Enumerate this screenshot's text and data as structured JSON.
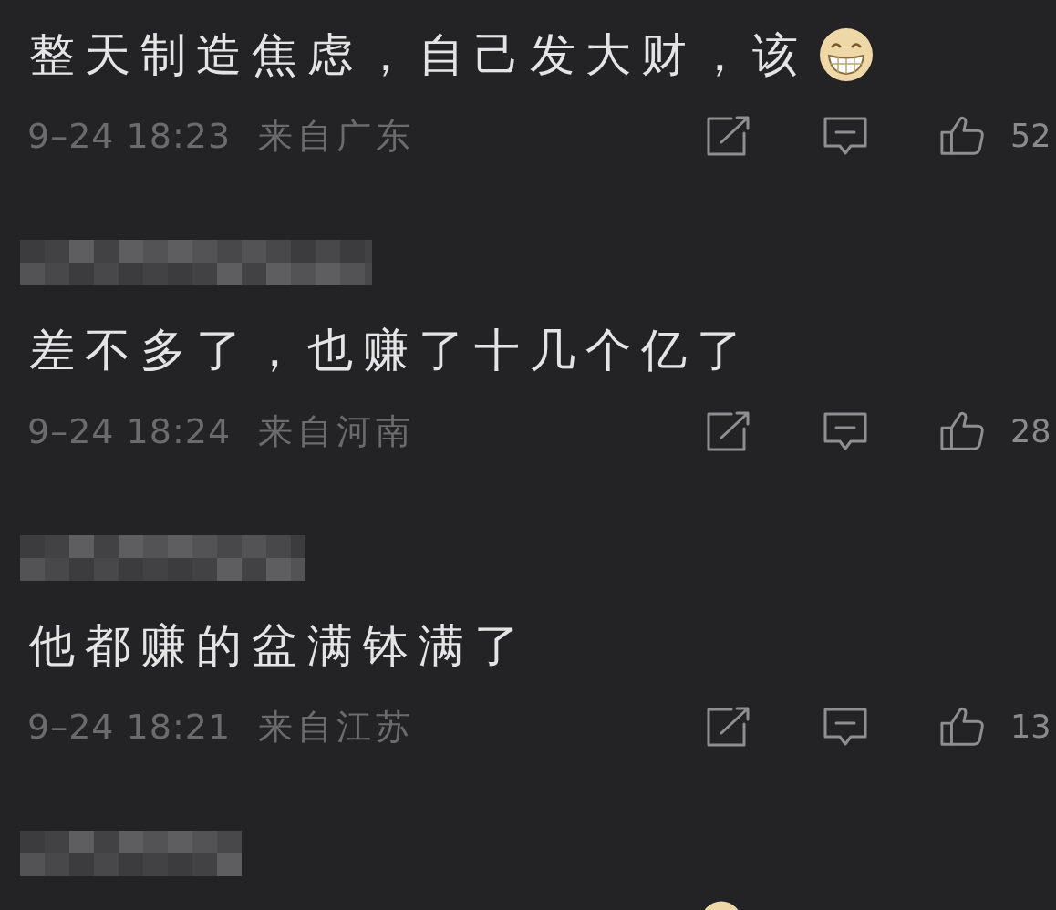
{
  "comments": [
    {
      "kind": "full",
      "username_shown": false,
      "text": "整天制造焦虑，自己发大财，该",
      "emoji": true,
      "time": "9–24 18:23",
      "location": "来自广东",
      "likes": "52"
    },
    {
      "kind": "full",
      "username_shown": true,
      "text": "差不多了，也赚了十几个亿了",
      "emoji": false,
      "time": "9–24 18:24",
      "location": "来自河南",
      "likes": "28"
    },
    {
      "kind": "full",
      "username_shown": true,
      "text": "他都赚的盆满钵满了",
      "emoji": false,
      "time": "9–24 18:21",
      "location": "来自江苏",
      "likes": "13"
    },
    {
      "kind": "cut",
      "username_shown": true,
      "emoji": true
    }
  ]
}
